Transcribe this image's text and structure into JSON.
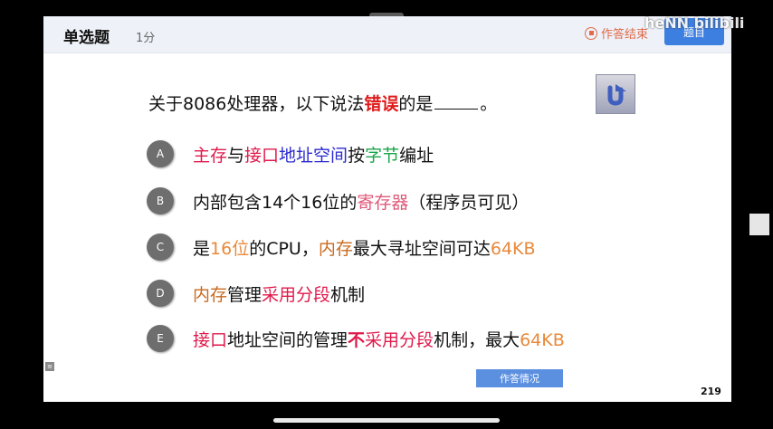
{
  "header": {
    "question_type": "单选题",
    "score": "1分",
    "end_label": "作答结束",
    "right_button": "题目",
    "watermark": "heNN bilibili"
  },
  "question": {
    "stem_before": "关于8086处理器，以下说法",
    "stem_emphasis": "错误",
    "stem_after": "的是",
    "stem_end": "。"
  },
  "options": [
    {
      "letter": "A",
      "segments": [
        {
          "t": "主存",
          "c": "red"
        },
        {
          "t": "与",
          "c": ""
        },
        {
          "t": "接口",
          "c": "red"
        },
        {
          "t": "地址空间",
          "c": "blue"
        },
        {
          "t": "按",
          "c": ""
        },
        {
          "t": "字节",
          "c": "green"
        },
        {
          "t": "编址",
          "c": ""
        }
      ]
    },
    {
      "letter": "B",
      "segments": [
        {
          "t": "内部包含14个16位的",
          "c": ""
        },
        {
          "t": "寄存器",
          "c": "pink"
        },
        {
          "t": "（程序员可见）",
          "c": ""
        }
      ]
    },
    {
      "letter": "C",
      "segments": [
        {
          "t": "是",
          "c": ""
        },
        {
          "t": "16位",
          "c": "orange"
        },
        {
          "t": "的CPU，",
          "c": ""
        },
        {
          "t": "内存",
          "c": "brown"
        },
        {
          "t": "最大寻址空间可达",
          "c": ""
        },
        {
          "t": "64KB",
          "c": "orange"
        }
      ]
    },
    {
      "letter": "D",
      "segments": [
        {
          "t": "内存",
          "c": "brown"
        },
        {
          "t": "管理",
          "c": ""
        },
        {
          "t": "采用分段",
          "c": "red"
        },
        {
          "t": "机制",
          "c": ""
        }
      ]
    },
    {
      "letter": "E",
      "segments": [
        {
          "t": "接口",
          "c": "red"
        },
        {
          "t": "地址空间的管理",
          "c": ""
        },
        {
          "t": "不",
          "c": "magenta-b"
        },
        {
          "t": "采用分段",
          "c": "red"
        },
        {
          "t": "机制，最大",
          "c": ""
        },
        {
          "t": "64KB",
          "c": "orange"
        }
      ]
    }
  ],
  "footer": {
    "status_button": "作答情况",
    "page_number": "219",
    "corner_mark": "≡"
  },
  "icons": {
    "undo": "undo-arrow-icon",
    "stop": "stop-circle-icon"
  }
}
